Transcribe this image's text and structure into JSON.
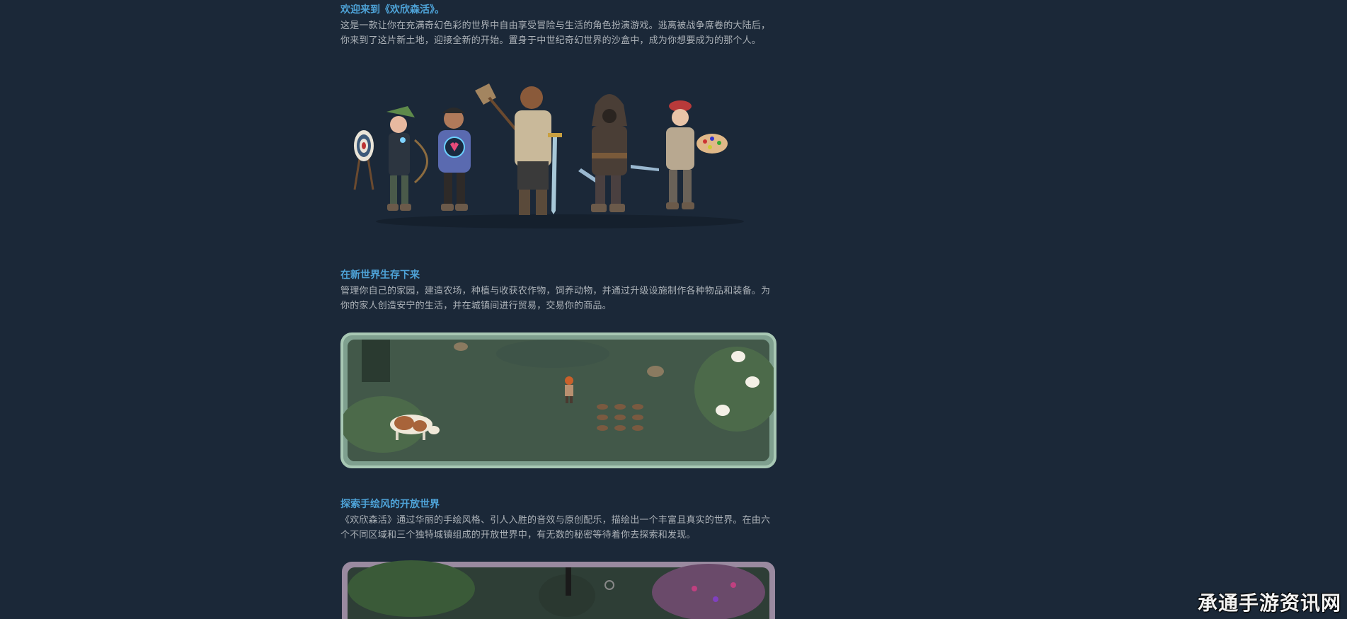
{
  "sections": [
    {
      "heading": "欢迎来到《欢欣森活》。",
      "text": "这是一款让你在充满奇幻色彩的世界中自由享受冒险与生活的角色扮演游戏。逃离被战争席卷的大陆后，你来到了这片新土地，迎接全新的开始。置身于中世纪奇幻世界的沙盒中，成为你想要成为的那个人。"
    },
    {
      "heading": "在新世界生存下来",
      "text": "管理你自己的家园，建造农场，种植与收获农作物，饲养动物，并通过升级设施制作各种物品和装备。为你的家人创造安宁的生活，并在城镇间进行贸易，交易你的商品。"
    },
    {
      "heading": "探索手绘风的开放世界",
      "text": "《欢欣森活》通过华丽的手绘风格、引人入胜的音效与原创配乐，描绘出一个丰富且真实的世界。在由六个不同区域和三个独特城镇组成的开放世界中，有无数的秘密等待着你去探索和发现。"
    }
  ],
  "watermark": "承通手游资讯网",
  "colors": {
    "background": "#1b2838",
    "heading": "#4ea3d8",
    "text": "#acb2b8"
  }
}
